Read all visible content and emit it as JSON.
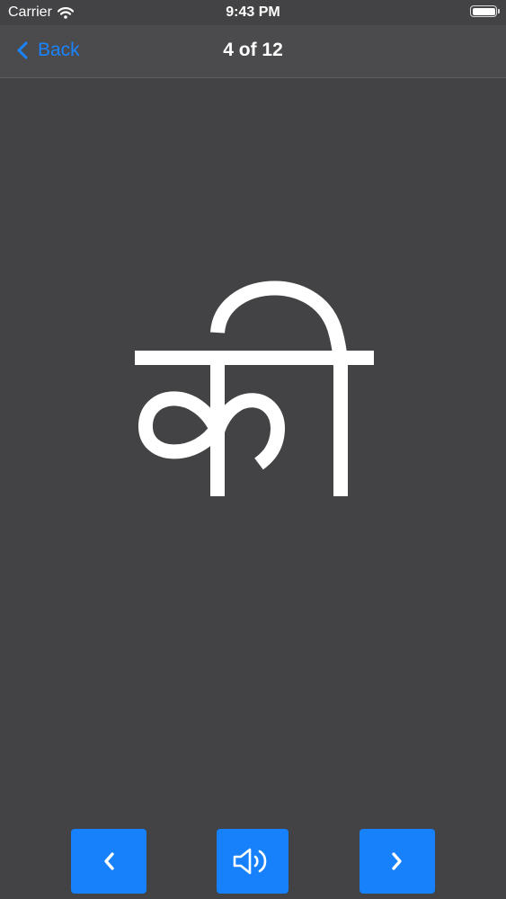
{
  "status_bar": {
    "carrier": "Carrier",
    "time": "9:43 PM",
    "battery_level": 1.0
  },
  "nav": {
    "back_label": "Back",
    "title": "4 of 12"
  },
  "card": {
    "character": "की"
  },
  "controls": {
    "previous_icon": "chevron-left-icon",
    "sound_icon": "speaker-icon",
    "next_icon": "chevron-right-icon"
  },
  "colors": {
    "background": "#434244",
    "navbar": "#4b4a4c",
    "accent": "#1a84ff",
    "button": "#1681fb",
    "glyph": "#ffffff"
  }
}
